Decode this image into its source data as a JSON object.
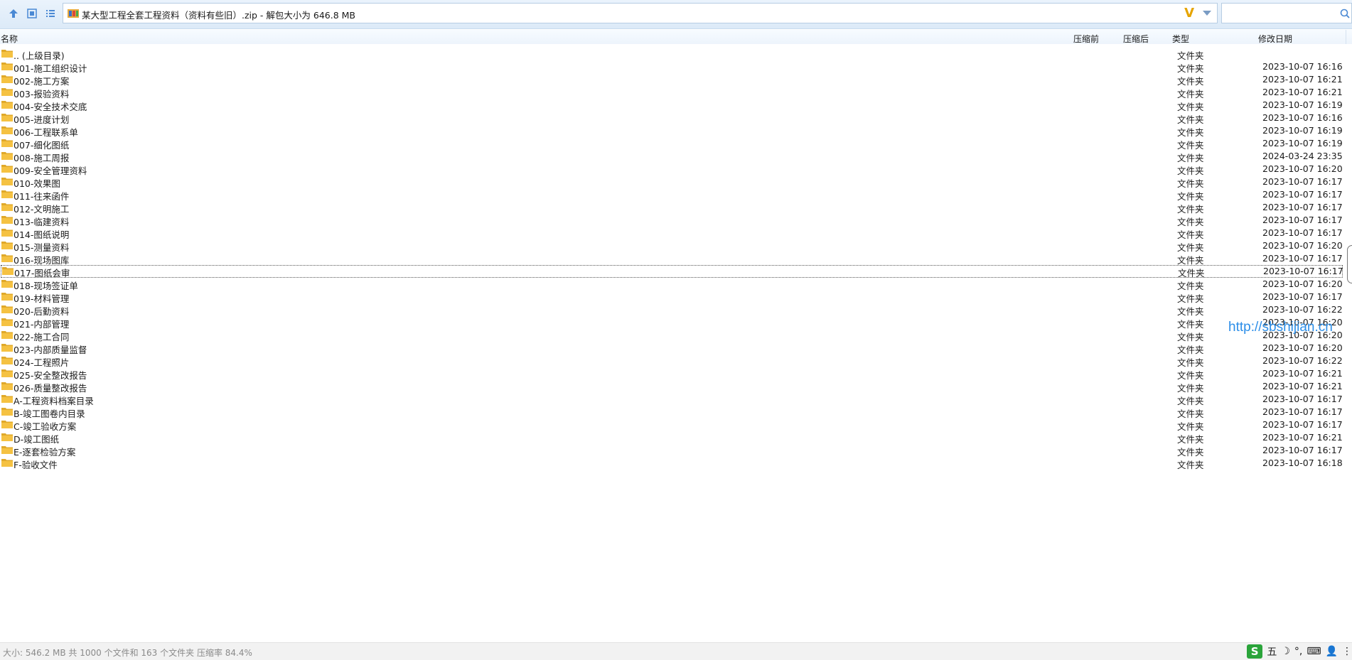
{
  "toolbar": {
    "up_icon": "arrow-up-icon",
    "thumbnail_icon": "thumbnail-view-icon",
    "list_icon": "list-view-icon"
  },
  "address": {
    "text": "某大型工程全套工程资料（资料有些旧）.zip - 解包大小为 646.8 MB",
    "badge": "V",
    "search_placeholder": ""
  },
  "columns": {
    "name": "名称",
    "before": "压缩前",
    "after": "压缩后",
    "type": "类型",
    "modified": "修改日期"
  },
  "rows": [
    {
      "name": ".. (上级目录)",
      "type": "文件夹",
      "date": ""
    },
    {
      "name": "001-施工组织设计",
      "type": "文件夹",
      "date": "2023-10-07 16:16"
    },
    {
      "name": "002-施工方案",
      "type": "文件夹",
      "date": "2023-10-07 16:21"
    },
    {
      "name": "003-报验资料",
      "type": "文件夹",
      "date": "2023-10-07 16:21"
    },
    {
      "name": "004-安全技术交底",
      "type": "文件夹",
      "date": "2023-10-07 16:19"
    },
    {
      "name": "005-进度计划",
      "type": "文件夹",
      "date": "2023-10-07 16:16"
    },
    {
      "name": "006-工程联系单",
      "type": "文件夹",
      "date": "2023-10-07 16:19"
    },
    {
      "name": "007-细化图纸",
      "type": "文件夹",
      "date": "2023-10-07 16:19"
    },
    {
      "name": "008-施工周报",
      "type": "文件夹",
      "date": "2024-03-24 23:35"
    },
    {
      "name": "009-安全管理资料",
      "type": "文件夹",
      "date": "2023-10-07 16:20"
    },
    {
      "name": "010-效果图",
      "type": "文件夹",
      "date": "2023-10-07 16:17"
    },
    {
      "name": "011-往来函件",
      "type": "文件夹",
      "date": "2023-10-07 16:17"
    },
    {
      "name": "012-文明施工",
      "type": "文件夹",
      "date": "2023-10-07 16:17"
    },
    {
      "name": "013-临建资料",
      "type": "文件夹",
      "date": "2023-10-07 16:17"
    },
    {
      "name": "014-图纸说明",
      "type": "文件夹",
      "date": "2023-10-07 16:17"
    },
    {
      "name": "015-测量资料",
      "type": "文件夹",
      "date": "2023-10-07 16:20"
    },
    {
      "name": "016-现场图库",
      "type": "文件夹",
      "date": "2023-10-07 16:17"
    },
    {
      "name": "017-图纸会审",
      "type": "文件夹",
      "date": "2023-10-07 16:17"
    },
    {
      "name": "018-现场签证单",
      "type": "文件夹",
      "date": "2023-10-07 16:20"
    },
    {
      "name": "019-材料管理",
      "type": "文件夹",
      "date": "2023-10-07 16:17"
    },
    {
      "name": "020-后勤资料",
      "type": "文件夹",
      "date": "2023-10-07 16:22"
    },
    {
      "name": "021-内部管理",
      "type": "文件夹",
      "date": "2023-10-07 16:20"
    },
    {
      "name": "022-施工合同",
      "type": "文件夹",
      "date": "2023-10-07 16:20"
    },
    {
      "name": "023-内部质量监督",
      "type": "文件夹",
      "date": "2023-10-07 16:20"
    },
    {
      "name": "024-工程照片",
      "type": "文件夹",
      "date": "2023-10-07 16:22"
    },
    {
      "name": "025-安全整改报告",
      "type": "文件夹",
      "date": "2023-10-07 16:21"
    },
    {
      "name": "026-质量整改报告",
      "type": "文件夹",
      "date": "2023-10-07 16:21"
    },
    {
      "name": "A-工程资料档案目录",
      "type": "文件夹",
      "date": "2023-10-07 16:17"
    },
    {
      "name": "B-竣工图卷内目录",
      "type": "文件夹",
      "date": "2023-10-07 16:17"
    },
    {
      "name": "C-竣工验收方案",
      "type": "文件夹",
      "date": "2023-10-07 16:17"
    },
    {
      "name": "D-竣工图纸",
      "type": "文件夹",
      "date": "2023-10-07 16:21"
    },
    {
      "name": "E-逐套检验方案",
      "type": "文件夹",
      "date": "2023-10-07 16:17"
    },
    {
      "name": "F-验收文件",
      "type": "文件夹",
      "date": "2023-10-07 16:18"
    }
  ],
  "selected_index": 17,
  "watermark": "http://sbshijian.cn",
  "status": {
    "text": "大小: 546.2 MB 共 1000 个文件和 163 个文件夹 压缩率 84.4%"
  },
  "ime": {
    "logo": "S",
    "mode": "五",
    "moon": "☽",
    "punct": "°,",
    "keyboard": "⌨",
    "user": "👤",
    "more": "⋮"
  },
  "colors": {
    "folder": "#f5c242",
    "accent": "#2c8ee8",
    "ime_green": "#2aa43a"
  }
}
